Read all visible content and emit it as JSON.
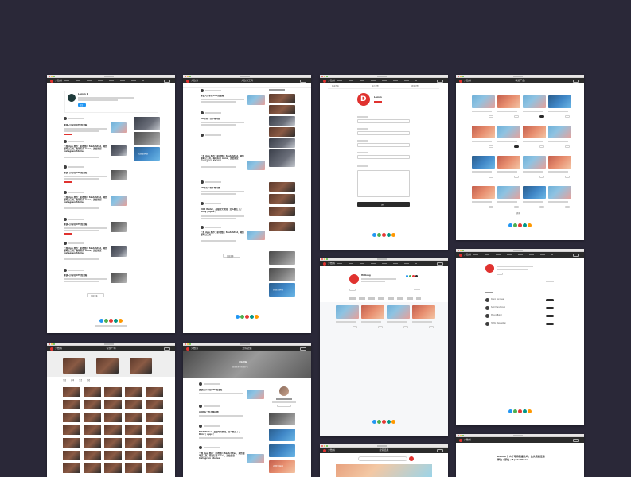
{
  "colors": {
    "background": "#2a2838",
    "brand_red": "#e0322f",
    "topbar": "#2b2b2b",
    "social_icons": [
      "#2196f3",
      "#4caf50",
      "#e53935",
      "#009688",
      "#ff9800"
    ]
  },
  "app": {
    "brand": "少数派"
  },
  "windows": {
    "home": {
      "profile_name": "Lemon 1",
      "follow_label": "关注",
      "load_more_label": "加载更多",
      "articles": [
        {
          "title": "趣谈只手掌控CPU加油箱"
        },
        {
          "title": "一周 App 推荐：新增图片 SketchPad、跨终端笔记工具，看看好用 icons、送给新宠 Instagram Stories"
        },
        {
          "title": "趣谈只手掌控CPU加油箱"
        },
        {
          "title": "一周 App 推荐：新增图片 SketchPad、跨终端笔记工具，看看好用 icons、送给新宠 Instagram Stories"
        },
        {
          "title": "趣谈只手掌控CPU加油箱"
        },
        {
          "title": "一周 App 推荐：新增图片 SketchPad、跨终端笔记工具，看看好用 icons、送给新宠 Instagram Stories"
        },
        {
          "title": "趣谈只手掌控CPU加油箱"
        }
      ],
      "side_banner": "高质量获取"
    },
    "column": {
      "title": "少数派工具",
      "articles": [
        {
          "title": "趣谈只手掌控CPU加油箱"
        },
        {
          "title": "AR原有一些不畅问题"
        },
        {
          "title": "一周 App 推荐：新增图片 SketchPad、跨终端笔记工具，看看好用 icons、送给新宠 Instagram Stories"
        },
        {
          "title": "AR原有一些不畅问题"
        },
        {
          "title": "Mild Water、夜猫时光倒流、怎么能忘了了 Dimy | Apps！"
        },
        {
          "title": "一周 App 推荐：新增图片 SketchPad、跨终端笔记工具"
        }
      ],
      "load_more_label": "加载更多",
      "side_banner": "高质量获取"
    },
    "editor": {
      "user_name": "Lemon",
      "tabs": [
        "基本资料",
        "账户设置",
        "消息设置"
      ],
      "save_label": "保存"
    },
    "products": {
      "title": "精选产品",
      "load_more_label": "更多"
    },
    "profile": {
      "user_name": "Hi-Doug"
    },
    "following": {
      "users": [
        {
          "name": "Dasin Penchaa"
        },
        {
          "name": "Saint Henderson"
        },
        {
          "name": "Mason Baker"
        },
        {
          "name": "Hotto Maxwellian"
        }
      ]
    },
    "gallery": {
      "title": "专题广场",
      "tabs": [
        "全部",
        "效率",
        "生活",
        "游戏"
      ]
    },
    "topic": {
      "title": "边玩边造",
      "banner_subtitle": "发现更多好的创作者",
      "articles": [
        {
          "title": "趣谈只手掌控CPU加油箱"
        },
        {
          "title": "AR原有一些不畅问题"
        },
        {
          "title": "Mild Water、夜猫时光倒流、怎么能忘了了 Dimy | Apps！"
        },
        {
          "title": "一周 App 推荐：新增图片 SketchPad、跨终端笔记工具，看看好用 icons、送给新宠 Instagram Stories"
        }
      ],
      "side_banner": "高质量获取"
    },
    "search": {
      "title": "搜索结果"
    },
    "article": {
      "headline": "Dumio 什么了等待我喜欢吗，这次我最佳推荐的 / 那位 / Apple Store"
    }
  }
}
